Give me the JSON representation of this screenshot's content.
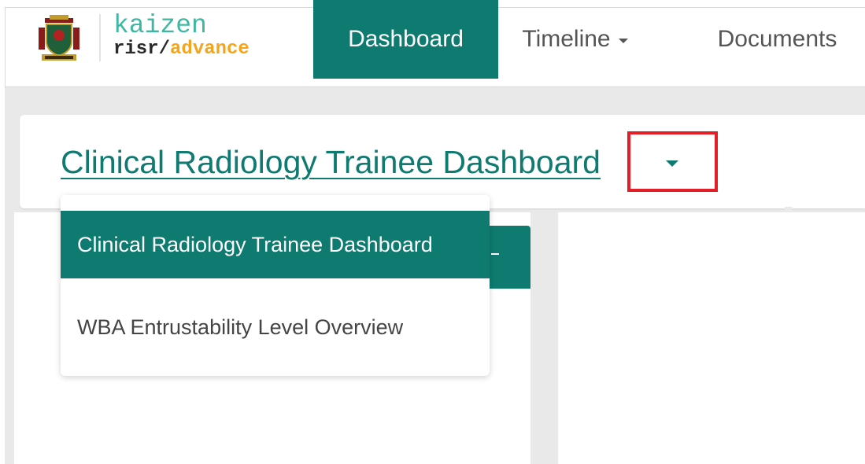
{
  "brand": {
    "name_top": "kaizen",
    "name_bottom_main": "risr/",
    "name_bottom_accent": "advance",
    "colors": {
      "teal": "#0e7a70",
      "teal_light": "#3fb7a3",
      "accent_orange": "#f4a51c",
      "highlight_red": "#e41e26"
    }
  },
  "nav": {
    "items": [
      {
        "label": "Dashboard",
        "active": true,
        "has_dropdown": false
      },
      {
        "label": "Timeline",
        "active": false,
        "has_dropdown": true
      },
      {
        "label": "Documents",
        "active": false,
        "has_dropdown": false
      }
    ]
  },
  "header": {
    "title": "Clinical Radiology Trainee Dashboard",
    "icons": {
      "logo": "crest-logo-icon",
      "caret": "caret-down-icon"
    }
  },
  "dropdown": {
    "items": [
      {
        "label": "Clinical Radiology Trainee Dashboard",
        "selected": true
      },
      {
        "label": "WBA Entrustability Level Overview",
        "selected": false
      }
    ]
  }
}
